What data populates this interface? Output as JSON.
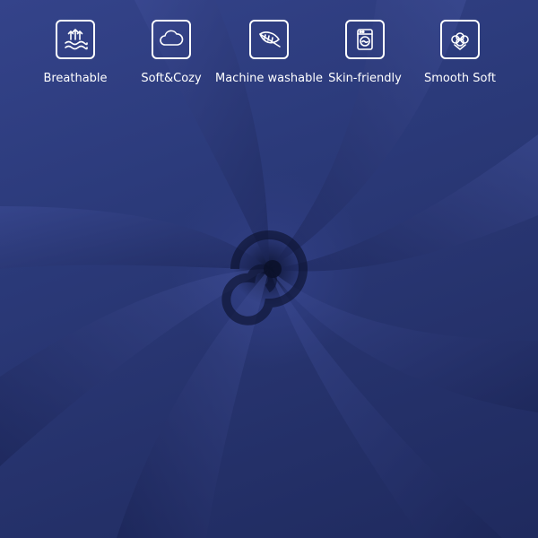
{
  "features": [
    {
      "label": "Breathable",
      "icon": "breathable-waves-icon"
    },
    {
      "label": "Soft&Cozy",
      "icon": "cloud-icon"
    },
    {
      "label": "Machine washable",
      "icon": "feather-icon"
    },
    {
      "label": "Skin-friendly",
      "icon": "washing-machine-icon"
    },
    {
      "label": "Smooth Soft",
      "icon": "cotton-icon"
    }
  ],
  "colors": {
    "fabric": "#2d3b78",
    "text": "#ffffff"
  }
}
